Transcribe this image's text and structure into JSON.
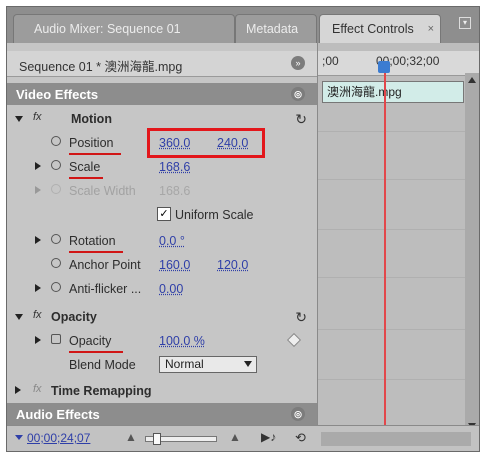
{
  "tabs": [
    {
      "label": "Audio Mixer: Sequence 01",
      "active": false
    },
    {
      "label": "Metadata",
      "active": false
    },
    {
      "label": "Effect Controls",
      "active": true
    }
  ],
  "sequence_label": "Sequence 01 * 澳洲海龍.mpg",
  "video_effects_header": "Video Effects",
  "motion": {
    "name": "Motion",
    "position": {
      "label": "Position",
      "x": "360.0",
      "y": "240.0"
    },
    "scale": {
      "label": "Scale",
      "value": "168.6"
    },
    "scale_width": {
      "label": "Scale Width",
      "value": "168.6"
    },
    "uniform_scale": {
      "label": "Uniform Scale",
      "checked": true
    },
    "rotation": {
      "label": "Rotation",
      "value": "0.0 °"
    },
    "anchor_point": {
      "label": "Anchor Point",
      "x": "160.0",
      "y": "120.0"
    },
    "anti_flicker": {
      "label": "Anti-flicker ...",
      "value": "0.00"
    }
  },
  "opacity": {
    "name": "Opacity",
    "opacity_prop": {
      "label": "Opacity",
      "value": "100.0 %"
    },
    "blend_mode": {
      "label": "Blend Mode",
      "value": "Normal"
    }
  },
  "time_remapping": "Time Remapping",
  "audio_effects_header": "Audio Effects",
  "footer_timecode": "00;00;24;07",
  "timeline": {
    "ruler_left": ";00",
    "ruler_right": "00;00;32;00",
    "clip_name": "澳洲海龍.mpg"
  },
  "colors": {
    "highlight_red": "#e3161b",
    "value_blue": "#2f3fa8",
    "clip_teal": "#d2ece8"
  }
}
